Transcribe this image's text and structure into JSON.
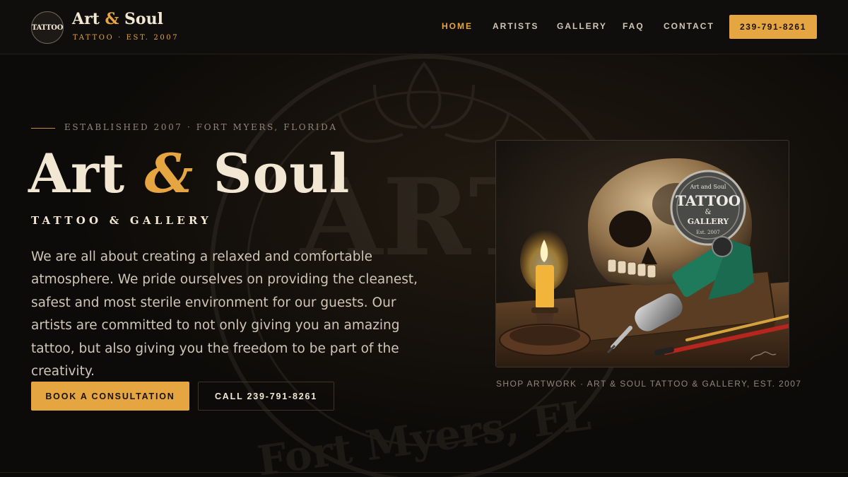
{
  "header": {
    "logo_text": "TATTOO",
    "brand_name_part1": "Art ",
    "brand_name_amp": "&",
    "brand_name_part2": " Soul",
    "brand_tagline": "TATTOO · EST. 2007",
    "nav": [
      {
        "label": "HOME",
        "active": true
      },
      {
        "label": "ARTISTS",
        "active": false
      },
      {
        "label": "GALLERY",
        "active": false
      },
      {
        "label": "FAQ",
        "active": false
      },
      {
        "label": "CONTACT",
        "active": false
      }
    ],
    "phone_button": "239-791-8261"
  },
  "hero": {
    "eyebrow": "ESTABLISHED 2007 · FORT MYERS, FLORIDA",
    "title_part1": "Art ",
    "title_amp": "&",
    "title_part2": " Soul",
    "subtitle": "TATTOO & GALLERY",
    "description": "We are all about creating a relaxed and comfortable atmosphere. We pride ourselves on providing the cleanest, safest and most sterile environment for our guests. Our artists are committed to not only giving you an amazing tattoo, but also giving you the freedom to be part of the creativity.",
    "primary_button": "BOOK A CONSULTATION",
    "secondary_button": "CALL 239-791-8261"
  },
  "artwork": {
    "badge_top": "Art and Soul",
    "badge_main": "TATTOO",
    "badge_amp": "&",
    "badge_sub": "GALLERY",
    "badge_est": "Est. 2007",
    "caption": "SHOP ARTWORK · ART & SOUL TATTOO & GALLERY, EST. 2007"
  },
  "background": {
    "seal_text": "Fort Myers, FL"
  },
  "colors": {
    "accent": "#e5a541",
    "background": "#0d0b09",
    "text_primary": "#f1e7d2",
    "text_muted": "#8f877a"
  }
}
